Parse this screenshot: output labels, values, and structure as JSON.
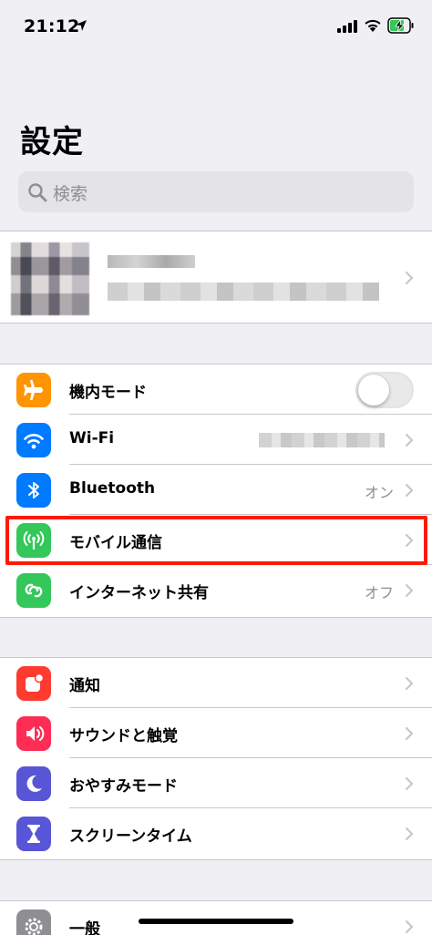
{
  "status_bar": {
    "time": "21:12",
    "icons": [
      "location-arrow-icon",
      "cellular-signal-icon",
      "wifi-icon",
      "battery-charging-icon"
    ]
  },
  "page_title": "設定",
  "search": {
    "placeholder": "検索"
  },
  "group_network": [
    {
      "id": "airplane",
      "label": "機内モード",
      "icon": "airplane-icon",
      "color": "#ff9500",
      "toggle": false
    },
    {
      "id": "wifi",
      "label": "Wi-Fi",
      "icon": "wifi-icon",
      "color": "#007aff"
    },
    {
      "id": "bluetooth",
      "label": "Bluetooth",
      "icon": "bluetooth-icon",
      "color": "#007aff",
      "value": "オン"
    },
    {
      "id": "cellular",
      "label": "モバイル通信",
      "icon": "antenna-icon",
      "color": "#34c759",
      "highlighted": true
    },
    {
      "id": "hotspot",
      "label": "インターネット共有",
      "icon": "hotspot-link-icon",
      "color": "#34c759",
      "value": "オフ"
    }
  ],
  "group_notify": [
    {
      "id": "notifications",
      "label": "通知",
      "icon": "notifications-icon",
      "color": "#ff3b30"
    },
    {
      "id": "sounds",
      "label": "サウンドと触覚",
      "icon": "speaker-icon",
      "color": "#ff2d55"
    },
    {
      "id": "dnd",
      "label": "おやすみモード",
      "icon": "moon-icon",
      "color": "#5856d6"
    },
    {
      "id": "screentime",
      "label": "スクリーンタイム",
      "icon": "hourglass-icon",
      "color": "#5856d6"
    }
  ],
  "group_general": [
    {
      "id": "general",
      "label": "一般",
      "icon": "gear-icon",
      "color": "#8e8e93"
    }
  ],
  "colors": {
    "highlight": "#ff1a00",
    "background": "#efeff4"
  }
}
